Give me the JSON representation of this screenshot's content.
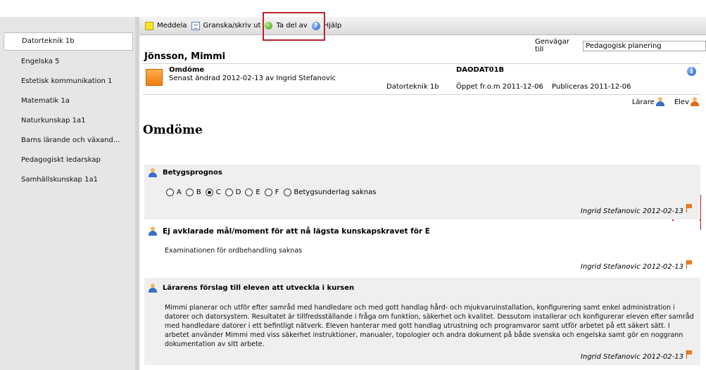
{
  "sidebar": {
    "items": [
      {
        "label": "Datorteknik 1b"
      },
      {
        "label": "Engelska 5"
      },
      {
        "label": "Estetisk kommunikation 1"
      },
      {
        "label": "Matematik 1a"
      },
      {
        "label": "Naturkunskap 1a1"
      },
      {
        "label": "Barns lärande och växand..."
      },
      {
        "label": "Pedagogiskt ledarskap"
      },
      {
        "label": "Samhällskunskap 1a1"
      }
    ]
  },
  "toolbar": {
    "meddela": "Meddela",
    "granska": "Granska/skriv ut",
    "tadelav": "Ta del av",
    "hjalp": "Hjälp"
  },
  "shortcut": {
    "label": "Genvägar till",
    "value": "Pedagogisk planering"
  },
  "student": {
    "name": "Jönsson, Mimmi"
  },
  "info": {
    "title": "Omdöme",
    "changed": "Senast ändrad 2012-02-13 av Ingrid Stefanovic",
    "course_code": "DAODAT01B",
    "course": "Datorteknik 1b",
    "open": "Öppet fr.o.m 2011-12-06",
    "published": "Publiceras 2011-12-06"
  },
  "roles": {
    "teacher": "Lärare",
    "student": "Elev"
  },
  "page_title": "Omdöme",
  "sections": [
    {
      "heading": "Betygsprognos",
      "grades": [
        "A",
        "B",
        "C",
        "D",
        "E",
        "F",
        "Betygsunderlag saknas"
      ],
      "selected": "C",
      "footer": "Ingrid Stefanovic 2012-02-13"
    },
    {
      "heading": "Ej avklarade mål/moment för att nå lägsta kunskapskravet för E",
      "body": "Examinationen för ordbehandling saknas",
      "footer": "Ingrid Stefanovic 2012-02-13"
    },
    {
      "heading": "Lärarens förslag till eleven att utveckla i kursen",
      "body": "Mimmi planerar och utför efter samråd med handledare och med gott handlag hård- och mjukvaruinstallation, konfigurering samt enkel administration i datorer och datorsystem. Resultatet är tillfredsställande i fråga om funktion, säkerhet och kvalitet. Dessutom installerar och konfigurerar eleven efter samråd med handledare datorer i ett befintligt nätverk. Eleven hanterar med gott handlag utrustning och programvaror samt utför arbetet på ett säkert sätt. I arbetet använder Mimmi med viss säkerhet instruktioner, manualer, topologier och andra dokument på både svenska och engelska samt gör en noggrann dokumentation av sitt arbete.",
      "footer": "Ingrid Stefanovic 2012-02-13"
    }
  ],
  "colors": {
    "highlight_box": "#b9232b",
    "sidebar": "#e6e6e6",
    "section_bg": "#efefef",
    "flag": "#f27a1a"
  }
}
